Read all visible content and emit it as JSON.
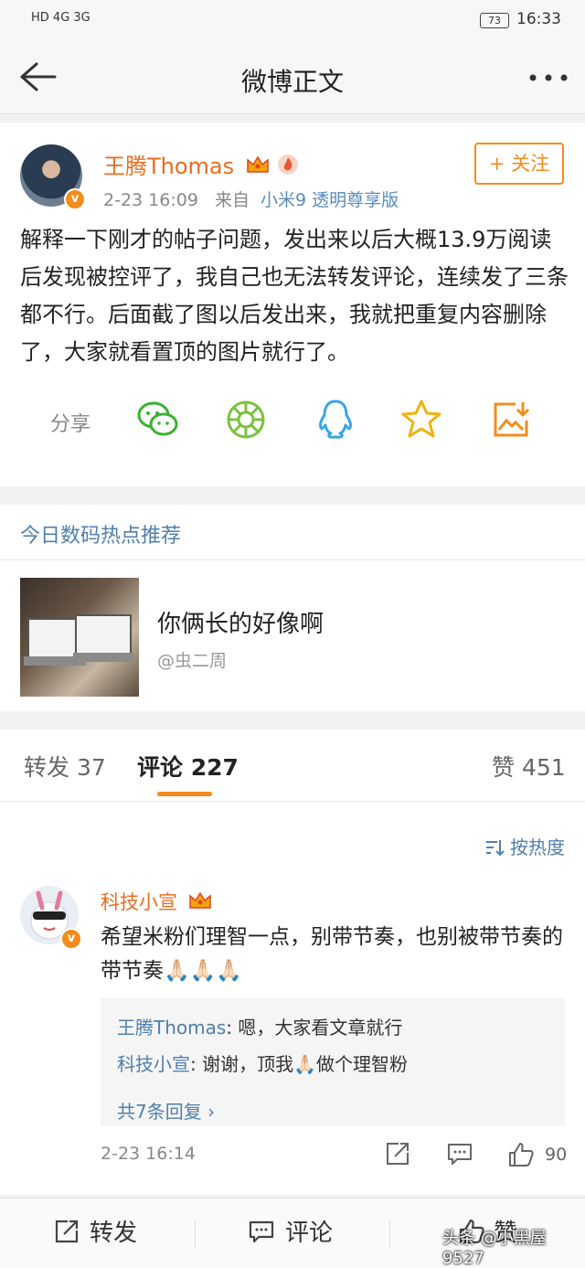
{
  "status_bar": {
    "left_icons": "HD 4G 3G",
    "battery": "73",
    "time": "16:33"
  },
  "nav": {
    "title": "微博正文",
    "back_icon": "back-arrow-icon",
    "more_icon": "more-dots-icon"
  },
  "post": {
    "username": "王腾Thomas",
    "date": "2-23 16:09",
    "source_prefix": "来自",
    "source": "小米9 透明尊享版",
    "follow_label": "+ 关注",
    "text": "解释一下刚才的帖子问题，发出来以后大概13.9万阅读后发现被控评了，我自己也无法转发评论，连续发了三条都不行。后面截了图以后发出来，我就把重复内容删除了，大家就看置顶的图片就行了。",
    "share_label": "分享"
  },
  "recommend": {
    "title": "今日数码热点推荐",
    "headline": "你俩长的好像啊",
    "author": "@虫二周"
  },
  "tabs": {
    "repost": "转发 37",
    "comment": "评论 227",
    "like": "赞 451"
  },
  "comments": {
    "sort_label": "按热度",
    "items": [
      {
        "user": "科技小宣",
        "text": "希望米粉们理智一点，别带节奏，也别被带节奏的带节奏🙏🏻🙏🏻🙏🏻",
        "replies": [
          {
            "name": "王腾Thomas",
            "text": ": 嗯，大家看文章就行"
          },
          {
            "name": "科技小宣",
            "text": ": 谢谢，顶我🙏🏻做个理智粉"
          }
        ],
        "more_replies": "共7条回复 ›",
        "time": "2-23 16:14",
        "likes": "90"
      }
    ]
  },
  "bottom_bar": {
    "repost": "转发",
    "comment": "评论",
    "like": "赞"
  },
  "watermark": "头条 @小黑屋9527",
  "colors": {
    "accent": "#f28c1b",
    "link": "#4f7fad",
    "username": "#e86d1f"
  }
}
